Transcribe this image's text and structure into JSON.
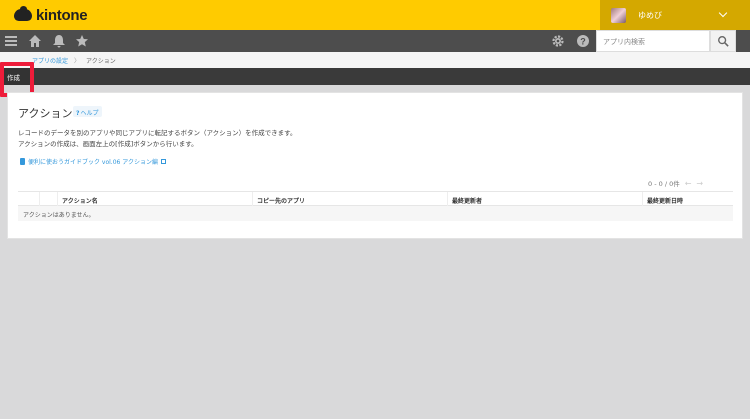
{
  "header": {
    "logo_text": "kintone",
    "user_name": "ゆめび"
  },
  "toolbar": {
    "search_placeholder": "アプリ内検索"
  },
  "breadcrumb": {
    "items": [
      "アプリの設定",
      "アクション"
    ]
  },
  "actionbar": {
    "create_label": "作成"
  },
  "panel": {
    "title": "アクション",
    "help_label": "ヘルプ",
    "description_line1": "レコードのデータを別のアプリや同じアプリに転記するボタン（アクション）を作成できます。",
    "description_line2": "アクションの作成は、画面左上の[作成]ボタンから行います。",
    "guide_link": "便利に使おうガイドブック vol.06 アクション編",
    "pager_text": "0 - 0 / 0件"
  },
  "table": {
    "columns": [
      "",
      "",
      "アクション名",
      "コピー先のアプリ",
      "最終更新者",
      "最終更新日時"
    ],
    "empty_message": "アクションはありません。"
  },
  "colors": {
    "header_yellow": "#ffcb00",
    "toolbar_gray": "#4d4d4d",
    "highlight_red": "#ee1c3a",
    "link_blue": "#3498db"
  }
}
